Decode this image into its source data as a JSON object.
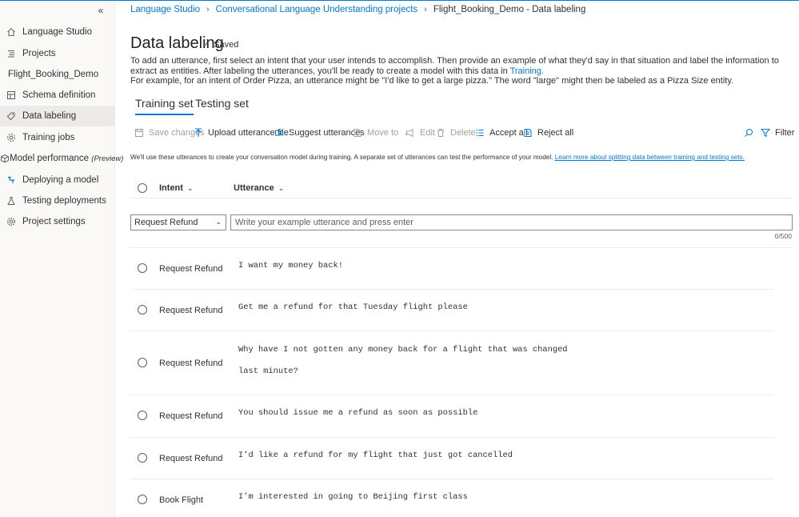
{
  "sidebar": {
    "collapse_label": "«",
    "project_name": "Flight_Booking_Demo",
    "items": [
      {
        "label": "Language Studio",
        "icon": "home-icon"
      },
      {
        "label": "Projects",
        "icon": "list-icon"
      },
      {
        "label": "Schema definition",
        "icon": "schema-icon"
      },
      {
        "label": "Data labeling",
        "icon": "tag-icon"
      },
      {
        "label": "Training jobs",
        "icon": "training-icon"
      },
      {
        "label": "Model performance",
        "suffix": "(Preview)",
        "icon": "cube-icon"
      },
      {
        "label": "Deploying a model",
        "icon": "deploy-icon"
      },
      {
        "label": "Testing deployments",
        "icon": "flask-icon"
      },
      {
        "label": "Project settings",
        "icon": "gear-icon"
      }
    ]
  },
  "breadcrumb": {
    "items": [
      "Language Studio",
      "Conversational Language Understanding projects"
    ],
    "current": "Flight_Booking_Demo - Data labeling"
  },
  "header": {
    "title": "Data labeling",
    "saved": "Saved",
    "description_1": "To add an utterance, first select an intent that your user intends to accomplish. Then provide an example of what they'd say in that situation and label the information to extract as entities. After labeling the utterances, you'll be ready to create a model with this data in ",
    "description_link": "Training.",
    "description_2": "For example, for an intent of Order Pizza, an utterance might be \"I'd like to get a large pizza.\" The word \"large\" might then be labeled as a Pizza Size entity."
  },
  "tabs": [
    {
      "label": "Training set",
      "active": true
    },
    {
      "label": "Testing set",
      "active": false
    }
  ],
  "toolbar": {
    "save_changes": "Save changes",
    "upload": "Upload utterance file",
    "suggest": "Suggest utterances",
    "move_to": "Move to",
    "edit": "Edit",
    "delete": "Delete",
    "accept_all": "Accept all",
    "reject_all": "Reject all",
    "filter": "Filter"
  },
  "note": {
    "text": "We'll use these utterances to create your conversation model during training. A separate set of utterances can test the performance of your model. ",
    "link": "Learn more about splitting data between training and testing sets."
  },
  "table": {
    "col_intent": "Intent",
    "col_utterance": "Utterance"
  },
  "input": {
    "selected_intent": "Request Refund",
    "placeholder": "Write your example utterance and press enter",
    "counter": "0/500"
  },
  "rows": [
    {
      "intent": "Request Refund",
      "utterance": "I want my money back!"
    },
    {
      "intent": "Request Refund",
      "utterance": "Get me a refund for that Tuesday flight please"
    },
    {
      "intent": "Request Refund",
      "utterance": "Why have I not gotten any money back for a flight that was changed\nlast minute?"
    },
    {
      "intent": "Request Refund",
      "utterance": "You should issue me a refund as soon as possible"
    },
    {
      "intent": "Request Refund",
      "utterance": "I’d like a refund for my flight that just got cancelled"
    },
    {
      "intent": "Book Flight",
      "utterance": "I’m interested in going to Beijing first class"
    }
  ]
}
